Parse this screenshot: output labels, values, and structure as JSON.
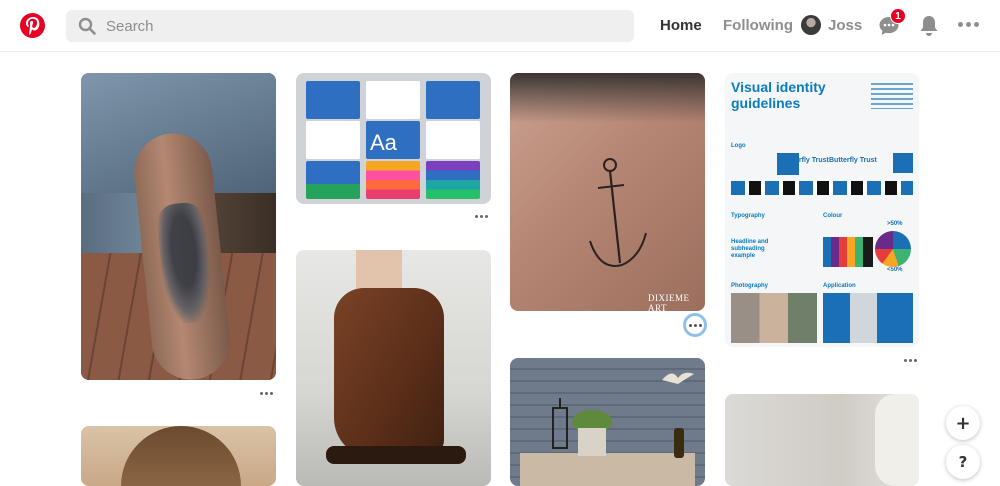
{
  "header": {
    "logo_icon": "pinterest-logo-icon",
    "brand_color": "#e60023",
    "search": {
      "placeholder": "Search",
      "value": "",
      "icon": "search-icon"
    },
    "nav": {
      "home": "Home",
      "following": "Following"
    },
    "user": {
      "name": "Joss"
    },
    "messages": {
      "icon": "speech-bubble-icon",
      "badge_count": "1"
    },
    "notifications": {
      "icon": "bell-icon"
    },
    "more": {
      "icon": "ellipsis-icon"
    }
  },
  "pins": [
    {
      "subject": "forearm tattoo with hands and text",
      "text": ""
    },
    {
      "subject": "brand identity cards",
      "text": "Aa"
    },
    {
      "subject": "anchor tattoo on forearm",
      "watermark": "DIXIEME ART"
    },
    {
      "subject": "visual identity guidelines poster",
      "title": "Visual identity guidelines",
      "sections": [
        "Logo",
        "Typography",
        "Colour",
        "Photography",
        "Application"
      ],
      "labels": [
        "Butterfly Trust",
        "Butterfly Trust",
        "Headline and subheading example",
        ">50%",
        "<50%"
      ]
    },
    {
      "subject": "brown leather ankle boots",
      "text": ""
    },
    {
      "subject": "garden bench with lantern, plant and wine",
      "text": ""
    },
    {
      "subject": "hand close-up",
      "text": ""
    },
    {
      "subject": "portrait with brown hair",
      "text": ""
    }
  ],
  "floating": {
    "add": "+",
    "help": "?"
  }
}
